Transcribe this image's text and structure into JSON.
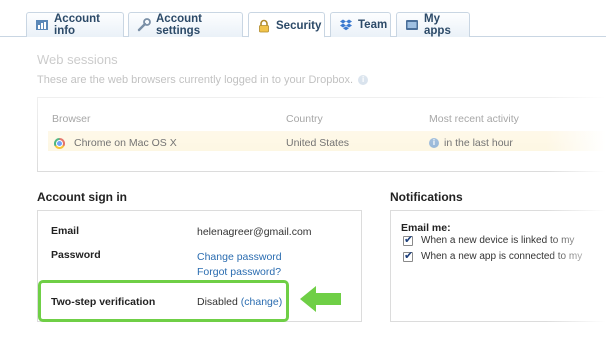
{
  "tabs": [
    {
      "label": "Account info",
      "icon": "account-info-icon"
    },
    {
      "label": "Account settings",
      "icon": "wrench-icon"
    },
    {
      "label": "Security",
      "icon": "lock-icon",
      "active": true
    },
    {
      "label": "Team",
      "icon": "dropbox-icon"
    },
    {
      "label": "My apps",
      "icon": "apps-icon"
    }
  ],
  "web_sessions": {
    "title": "Web sessions",
    "description": "These are the web browsers currently logged in to your Dropbox.",
    "headers": {
      "browser": "Browser",
      "country": "Country",
      "activity": "Most recent activity"
    },
    "row": {
      "browser": "Chrome on Mac OS X",
      "country": "United States",
      "activity": "in the last hour"
    }
  },
  "account_sign_in": {
    "title": "Account sign in",
    "email_label": "Email",
    "email_value": "helenagreer@gmail.com",
    "password_label": "Password",
    "change_password": "Change password",
    "forgot_password": "Forgot password?",
    "two_step_label": "Two-step verification",
    "two_step_status": "Disabled",
    "two_step_change": "(change)"
  },
  "notifications": {
    "title": "Notifications",
    "email_me": "Email me:",
    "options": [
      {
        "label": "When a new device is linked to my",
        "checked": true
      },
      {
        "label": "When a new app is connected to my",
        "checked": true
      }
    ]
  },
  "colors": {
    "highlight": "#6fcf46",
    "arrow": "#6fcf46",
    "link": "#2a6cb0",
    "tab_text": "#2c4a68",
    "session_row": "#fdf5dd"
  }
}
